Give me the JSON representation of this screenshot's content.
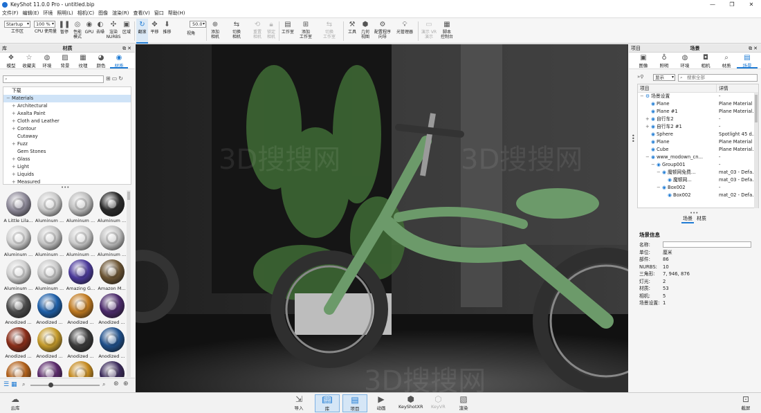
{
  "app": {
    "title": "KeyShot 11.0.0 Pro  -  untitled.bip"
  },
  "menu": [
    "文件(F)",
    "编辑(E)",
    "环境",
    "照明(L)",
    "相机(C)",
    "图像",
    "渲染(R)",
    "查看(V)",
    "窗口",
    "帮助(H)"
  ],
  "toolbar": {
    "workspace_select": "Startup",
    "zoom_select": "100 %",
    "fov_value": "50.0",
    "buttons": {
      "workspace": "工作区",
      "cpu": "CPU 使用量",
      "pause": "暂停",
      "perf": "性能\n模式",
      "gpu": "GPU",
      "denoise": "去噪",
      "nurbs": "渲染\nNURBS",
      "region": "区域",
      "tumble": "翻滚",
      "pan": "平移",
      "dolly": "推移",
      "view_angle": "视角",
      "add_camera": "添加\n相机",
      "switch_camera": "切换\n相机",
      "reset_camera": "重置\n相机",
      "lock_camera": "锁定\n相机",
      "studio": "工作室",
      "add_studio": "添加\n工作室",
      "switch_studio": "切换\n工作室",
      "tools": "工具",
      "geometry_view": "几何\n视图",
      "config_wizard": "配置程序\n向导",
      "light_manager": "光管理器",
      "ar_vr": "演示 VR\n演示",
      "script_console": "脚本\n控制台"
    }
  },
  "library": {
    "panel_title_left": "库",
    "panel_title": "材质",
    "tabs": [
      "模型",
      "收藏夹",
      "环境",
      "背景",
      "纹理",
      "颜色",
      "材质"
    ],
    "active_tab": "材质",
    "search_placeholder": "",
    "tree": [
      {
        "label": "下载",
        "indent": 0,
        "expander": ""
      },
      {
        "label": "Materials",
        "indent": 0,
        "expander": "−",
        "selected": true
      },
      {
        "label": "Architectural",
        "indent": 1,
        "expander": "+"
      },
      {
        "label": "Axalta Paint",
        "indent": 1,
        "expander": "+"
      },
      {
        "label": "Cloth and Leather",
        "indent": 1,
        "expander": "+"
      },
      {
        "label": "Contour",
        "indent": 1,
        "expander": "+"
      },
      {
        "label": "Cutaway",
        "indent": 1,
        "expander": ""
      },
      {
        "label": "Fuzz",
        "indent": 1,
        "expander": "+"
      },
      {
        "label": "Gem Stones",
        "indent": 1,
        "expander": ""
      },
      {
        "label": "Glass",
        "indent": 1,
        "expander": "+"
      },
      {
        "label": "Light",
        "indent": 1,
        "expander": "+"
      },
      {
        "label": "Liquids",
        "indent": 1,
        "expander": "+"
      },
      {
        "label": "Measured",
        "indent": 1,
        "expander": "+"
      }
    ],
    "thumbnails": [
      {
        "label": "A Little Lila...",
        "color": "#8e8a99"
      },
      {
        "label": "Aluminum ...",
        "color": "#c9c9c9"
      },
      {
        "label": "Aluminum ...",
        "color": "#bdbdbd"
      },
      {
        "label": "Aluminum ...",
        "color": "#2a2a2a"
      },
      {
        "label": "Aluminum ...",
        "color": "#d0d0d0"
      },
      {
        "label": "Aluminum ...",
        "color": "#c4c4c4"
      },
      {
        "label": "Aluminum ...",
        "color": "#cbcbcb"
      },
      {
        "label": "Aluminum ...",
        "color": "#bfbfbf"
      },
      {
        "label": "Aluminum ...",
        "color": "#cfcfcf"
      },
      {
        "label": "Aluminum ...",
        "color": "#c8c8c8"
      },
      {
        "label": "Amazing G...",
        "color": "#4b3a9a"
      },
      {
        "label": "Amazon M...",
        "color": "#6b5433"
      },
      {
        "label": "Anodized ...",
        "color": "#4a4a4a"
      },
      {
        "label": "Anodized ...",
        "color": "#1e5fa8"
      },
      {
        "label": "Anodized ...",
        "color": "#c07a20"
      },
      {
        "label": "Anodized ...",
        "color": "#4b2a6b"
      },
      {
        "label": "Anodized ...",
        "color": "#8a2e1a"
      },
      {
        "label": "Anodized ...",
        "color": "#c49a2a"
      },
      {
        "label": "Anodized ...",
        "color": "#3a3a3a"
      },
      {
        "label": "Anodized ...",
        "color": "#1f4f8a"
      },
      {
        "label": "",
        "color": "#b0601a"
      },
      {
        "label": "",
        "color": "#5a2a6a"
      },
      {
        "label": "",
        "color": "#c48a20"
      },
      {
        "label": "",
        "color": "#3a2a5a"
      }
    ]
  },
  "project": {
    "panel_title_left": "项目",
    "panel_title": "场景",
    "tabs": [
      "图像",
      "照明",
      "环境",
      "相机",
      "材质",
      "场景"
    ],
    "active_tab": "场景",
    "show_select": "显示",
    "search_placeholder": "搜索全部",
    "col_item": "项目",
    "col_detail": "详情",
    "rows": [
      {
        "name": "场景设置",
        "detail": "-",
        "indent": 0,
        "expander": "−"
      },
      {
        "name": "Plane",
        "detail": "Plane Material",
        "indent": 1,
        "expander": ""
      },
      {
        "name": "Plane #1",
        "detail": "Plane Material...",
        "indent": 1,
        "expander": ""
      },
      {
        "name": "自行车2",
        "detail": "-",
        "indent": 1,
        "expander": "+"
      },
      {
        "name": "自行车2 #1",
        "detail": "-",
        "indent": 1,
        "expander": "+"
      },
      {
        "name": "Sphere",
        "detail": "Spotlight 45 d...",
        "indent": 1,
        "expander": ""
      },
      {
        "name": "Plane",
        "detail": "Plane Material",
        "indent": 1,
        "expander": ""
      },
      {
        "name": "Cube",
        "detail": "Plane Material...",
        "indent": 1,
        "expander": ""
      },
      {
        "name": "www_modown_cn...",
        "detail": "-",
        "indent": 1,
        "expander": "−"
      },
      {
        "name": "Group001",
        "detail": "-",
        "indent": 2,
        "expander": "−"
      },
      {
        "name": "魔顿网免费...",
        "detail": "mat_03 - Defa...",
        "indent": 3,
        "expander": "−"
      },
      {
        "name": "魔顿网...",
        "detail": "mat_03 - Defa...",
        "indent": 4,
        "expander": ""
      },
      {
        "name": "Box002",
        "detail": "-",
        "indent": 3,
        "expander": "−"
      },
      {
        "name": "Box002",
        "detail": "mat_02 - Defa...",
        "indent": 4,
        "expander": ""
      }
    ],
    "subtabs": [
      "场景",
      "材质"
    ],
    "active_subtab": "场景",
    "info_title": "场景信息",
    "info": [
      {
        "k": "名称:",
        "v": ""
      },
      {
        "k": "单位:",
        "v": "厘米"
      },
      {
        "k": "部件:",
        "v": "86"
      },
      {
        "k": "NURBS:",
        "v": "10"
      },
      {
        "k": "三角形:",
        "v": "7, 946, 876"
      },
      {
        "k": "灯光:",
        "v": "2"
      },
      {
        "k": "材质:",
        "v": "53"
      },
      {
        "k": "相机:",
        "v": "5"
      },
      {
        "k": "场景设置:",
        "v": "1"
      }
    ]
  },
  "bottom": {
    "cloud": "云库",
    "import": "导入",
    "library": "库",
    "project": "项目",
    "animation": "动画",
    "keyshotxr": "KeyShotXR",
    "keyvr": "KeyVR",
    "render": "渲染",
    "screenshot": "截屏"
  },
  "viewport": {
    "watermark": "3D搜搜网",
    "bike_color": "#6c9a6a"
  }
}
